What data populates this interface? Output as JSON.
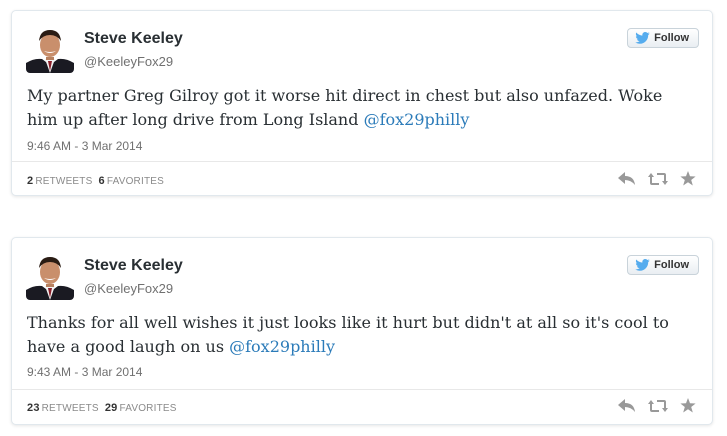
{
  "tweets": [
    {
      "author": "Steve Keeley",
      "handle": "@KeeleyFox29",
      "follow_label": "Follow",
      "text": "My partner Greg Gilroy got it worse hit direct in chest but also unfazed. Woke him up after long drive from Long Island ",
      "mention": "@fox29philly",
      "timestamp": "9:46 AM - 3 Mar 2014",
      "retweets_count": "2",
      "retweets_label": "RETWEETS",
      "favorites_count": "6",
      "favorites_label": "FAVORITES"
    },
    {
      "author": "Steve Keeley",
      "handle": "@KeeleyFox29",
      "follow_label": "Follow",
      "text": "Thanks for all well wishes it just looks like it hurt but didn't at all so it's cool to  have a good laugh on us ",
      "mention": "@fox29philly",
      "timestamp": "9:43 AM - 3 Mar 2014",
      "retweets_count": "23",
      "retweets_label": "RETWEETS",
      "favorites_count": "29",
      "favorites_label": "FAVORITES"
    }
  ],
  "colors": {
    "link": "#2b7bb9",
    "twitter_bird": "#55acee",
    "text": "#292f33",
    "muted": "#707070"
  },
  "icons": [
    "twitter-bird-icon",
    "reply-icon",
    "retweet-icon",
    "favorite-icon"
  ]
}
